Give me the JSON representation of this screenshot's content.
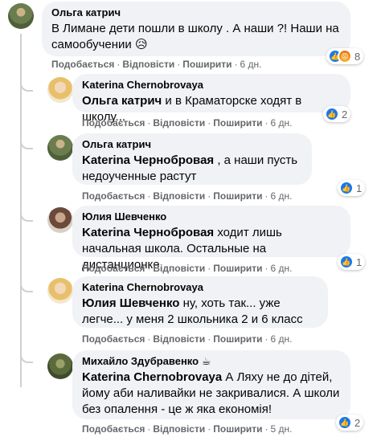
{
  "comments": [
    {
      "author": "Ольга катрич",
      "text": "В Лимане дети пошли в школу . А наши ?! Наши на самообучении 😥",
      "like": "Подобається",
      "reply": "Відповісти",
      "share": "Поширити",
      "time": "6 дн.",
      "reaction_count": "8"
    },
    {
      "author": "Katerina Chernobrovaya",
      "mention": "Ольга катрич",
      "text": " и в Краматорске ходят в школу...",
      "like": "Подобається",
      "reply": "Відповісти",
      "share": "Поширити",
      "time": "6 дн.",
      "reaction_count": "2"
    },
    {
      "author": "Ольга катрич",
      "mention": "Katerina Чернобровая",
      "text": " , а наши пусть недоученные растут",
      "like": "Подобається",
      "reply": "Відповісти",
      "share": "Поширити",
      "time": "6 дн.",
      "reaction_count": "1"
    },
    {
      "author": "Юлия Шевченко",
      "mention": "Katerina Чернобровая",
      "text": " ходит лишь начальная школа. Остальные на дистанционке",
      "like": "Подобається",
      "reply": "Відповісти",
      "share": "Поширити",
      "time": "6 дн.",
      "reaction_count": "1"
    },
    {
      "author": "Katerina Chernobrovaya",
      "mention": "Юлия Шевченко",
      "text": " ну, хоть так... уже легче... у меня 2 школьника 2 и 6 класс",
      "like": "Подобається",
      "reply": "Відповісти",
      "share": "Поширити",
      "time": "6 дн."
    },
    {
      "author": "Михайло Здубравенко",
      "author_badge": "☕",
      "mention": "Katerina Chernobrovaya",
      "text": " А Ляху не до дітей, йому аби наливайки не закривалися. А школи без опалення - це ж яка економія!",
      "like": "Подобається",
      "reply": "Відповісти",
      "share": "Поширити",
      "time": "5 дн.",
      "reaction_count": "2"
    }
  ],
  "colors": {
    "bubble": "#f0f2f5",
    "meta": "#65676b",
    "like": "#1877f2",
    "thread": "#ced0d4"
  }
}
